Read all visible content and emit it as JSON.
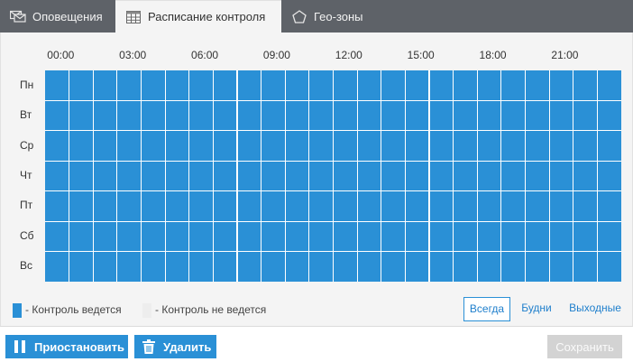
{
  "tabs": [
    {
      "label": "Оповещения",
      "icon": "envelopes-icon",
      "active": false
    },
    {
      "label": "Расписание контроля",
      "icon": "calendar-grid-icon",
      "active": true
    },
    {
      "label": "Гео-зоны",
      "icon": "pentagon-icon",
      "active": false
    }
  ],
  "schedule": {
    "hour_labels": [
      "00:00",
      "03:00",
      "06:00",
      "09:00",
      "12:00",
      "15:00",
      "18:00",
      "21:00"
    ],
    "days": [
      "Пн",
      "Вт",
      "Ср",
      "Чт",
      "Пт",
      "Сб",
      "Вс"
    ],
    "slots_per_day": 24,
    "active_color": "#2a90d6",
    "inactive_color": "#ededed",
    "active": [
      [
        1,
        1,
        1,
        1,
        1,
        1,
        1,
        1,
        1,
        1,
        1,
        1,
        1,
        1,
        1,
        1,
        1,
        1,
        1,
        1,
        1,
        1,
        1,
        1
      ],
      [
        1,
        1,
        1,
        1,
        1,
        1,
        1,
        1,
        1,
        1,
        1,
        1,
        1,
        1,
        1,
        1,
        1,
        1,
        1,
        1,
        1,
        1,
        1,
        1
      ],
      [
        1,
        1,
        1,
        1,
        1,
        1,
        1,
        1,
        1,
        1,
        1,
        1,
        1,
        1,
        1,
        1,
        1,
        1,
        1,
        1,
        1,
        1,
        1,
        1
      ],
      [
        1,
        1,
        1,
        1,
        1,
        1,
        1,
        1,
        1,
        1,
        1,
        1,
        1,
        1,
        1,
        1,
        1,
        1,
        1,
        1,
        1,
        1,
        1,
        1
      ],
      [
        1,
        1,
        1,
        1,
        1,
        1,
        1,
        1,
        1,
        1,
        1,
        1,
        1,
        1,
        1,
        1,
        1,
        1,
        1,
        1,
        1,
        1,
        1,
        1
      ],
      [
        1,
        1,
        1,
        1,
        1,
        1,
        1,
        1,
        1,
        1,
        1,
        1,
        1,
        1,
        1,
        1,
        1,
        1,
        1,
        1,
        1,
        1,
        1,
        1
      ],
      [
        1,
        1,
        1,
        1,
        1,
        1,
        1,
        1,
        1,
        1,
        1,
        1,
        1,
        1,
        1,
        1,
        1,
        1,
        1,
        1,
        1,
        1,
        1,
        1
      ]
    ]
  },
  "legend": {
    "on_label": "- Контроль ведется",
    "off_label": "- Контроль не ведется"
  },
  "filters": {
    "always": "Всегда",
    "weekdays": "Будни",
    "weekends": "Выходные",
    "selected": "always"
  },
  "footer": {
    "pause_label": "Приостановить",
    "delete_label": "Удалить",
    "save_label": "Сохранить"
  }
}
